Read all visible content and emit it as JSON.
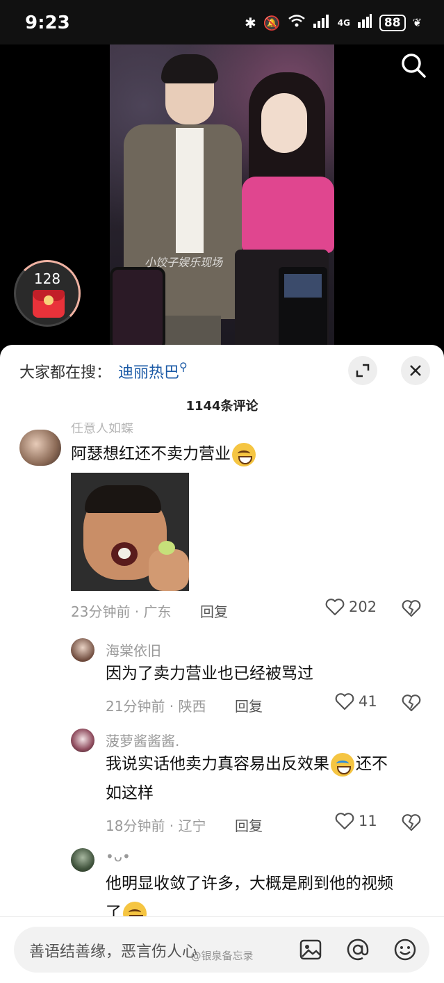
{
  "status_bar": {
    "time": "9:23",
    "network": "4G",
    "battery": "88"
  },
  "video": {
    "watermark": "小饺子娱乐现场"
  },
  "red_packet": {
    "count": "128"
  },
  "sheet": {
    "hot_search_label": "大家都在搜：",
    "hot_search_term": "迪丽热巴",
    "comment_count": "1144条评论"
  },
  "comments": [
    {
      "user": "任意人如蝶",
      "text": "阿瑟想红还不卖力营业",
      "time": "23分钟前",
      "location": "广东",
      "reply": "回复",
      "likes": "202"
    },
    {
      "user": "海棠依旧",
      "text": "因为了卖力营业也已经被骂过",
      "time": "21分钟前",
      "location": "陕西",
      "reply": "回复",
      "likes": "41"
    },
    {
      "user": "菠萝酱酱酱.",
      "text_line1": "我说实话他卖力真容易出反效果",
      "text_line1_tail": "还不",
      "text_line2": "如这样",
      "time": "18分钟前",
      "location": "辽宁",
      "reply": "回复",
      "likes": "11"
    },
    {
      "user": "•ᴗ•",
      "text_line1": "他明显收敛了许多，大概是刷到他的视频",
      "text_line2": "了"
    }
  ],
  "input": {
    "placeholder": "善语结善缘，恶言伤人心"
  },
  "bottom_watermark": "@银泉备忘录",
  "colors": {
    "accent_link": "#1b5aa6",
    "envelope_red": "#e9323a"
  }
}
